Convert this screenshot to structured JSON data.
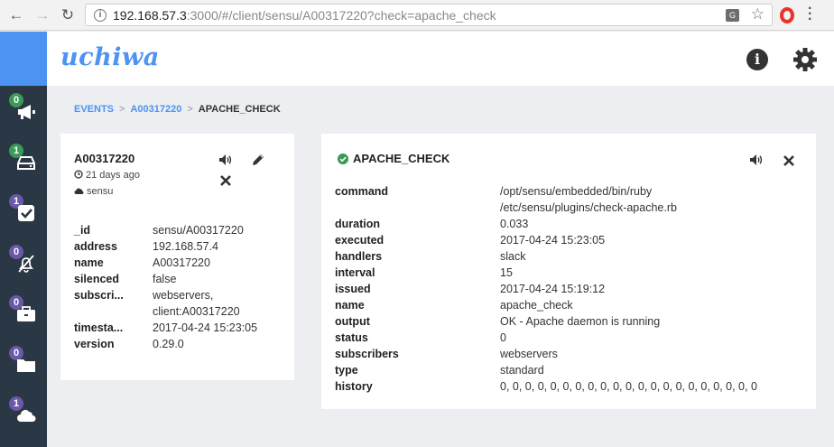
{
  "browser": {
    "url_host": "192.168.57.3",
    "url_rest": ":3000/#/client/sensu/A00317220?check=apache_check"
  },
  "app": {
    "logo": "uchiwa",
    "info_label": "i"
  },
  "sidebar": {
    "items": [
      {
        "name": "events",
        "count": "0",
        "badge": "green",
        "icon": "megaphone-icon"
      },
      {
        "name": "clients",
        "count": "1",
        "badge": "green",
        "icon": "server-icon"
      },
      {
        "name": "checks",
        "count": "1",
        "badge": "purple",
        "icon": "check-square-icon"
      },
      {
        "name": "silenced",
        "count": "0",
        "badge": "purple",
        "icon": "bell-slash-icon"
      },
      {
        "name": "stashes",
        "count": "0",
        "badge": "purple",
        "icon": "briefcase-icon"
      },
      {
        "name": "aggregates",
        "count": "0",
        "badge": "purple",
        "icon": "folder-icon"
      },
      {
        "name": "datacenters",
        "count": "1",
        "badge": "purple",
        "icon": "cloud-icon"
      }
    ]
  },
  "breadcrumb": {
    "events": "EVENTS",
    "client": "A00317220",
    "current": "APACHE_CHECK",
    "separator": ">"
  },
  "client": {
    "name": "A00317220",
    "last_seen": "21 days ago",
    "datacenter": "sensu",
    "fields": [
      {
        "key": "_id",
        "value": "sensu/A00317220"
      },
      {
        "key": "address",
        "value": "192.168.57.4"
      },
      {
        "key": "name",
        "value": "A00317220"
      },
      {
        "key": "silenced",
        "value": "false"
      },
      {
        "key": "subscri...",
        "value": "webservers,",
        "value2": "client:A00317220"
      },
      {
        "key": "timesta...",
        "value": "2017-04-24 15:23:05"
      },
      {
        "key": "version",
        "value": "0.29.0"
      }
    ]
  },
  "check": {
    "title": "APACHE_CHECK",
    "status_color": "#3a9b57",
    "fields": [
      {
        "key": "command",
        "value": "/opt/sensu/embedded/bin/ruby",
        "value2": "/etc/sensu/plugins/check-apache.rb"
      },
      {
        "key": "duration",
        "value": "0.033"
      },
      {
        "key": "executed",
        "value": "2017-04-24 15:23:05"
      },
      {
        "key": "handlers",
        "value": "slack"
      },
      {
        "key": "interval",
        "value": "15"
      },
      {
        "key": "issued",
        "value": "2017-04-24 15:19:12"
      },
      {
        "key": "name",
        "value": "apache_check"
      },
      {
        "key": "output",
        "value": "OK - Apache daemon is running"
      },
      {
        "key": "status",
        "value": "0"
      },
      {
        "key": "subscribers",
        "value": "webservers"
      },
      {
        "key": "type",
        "value": "standard"
      },
      {
        "key": "history",
        "value": "0, 0, 0, 0, 0, 0, 0, 0, 0, 0, 0, 0, 0, 0, 0, 0, 0, 0, 0, 0, 0"
      }
    ]
  },
  "colors": {
    "accent": "#4d93f2",
    "sidebar": "#2a3744",
    "ok": "#3a9b57",
    "badge_purple": "#6b58a8"
  }
}
